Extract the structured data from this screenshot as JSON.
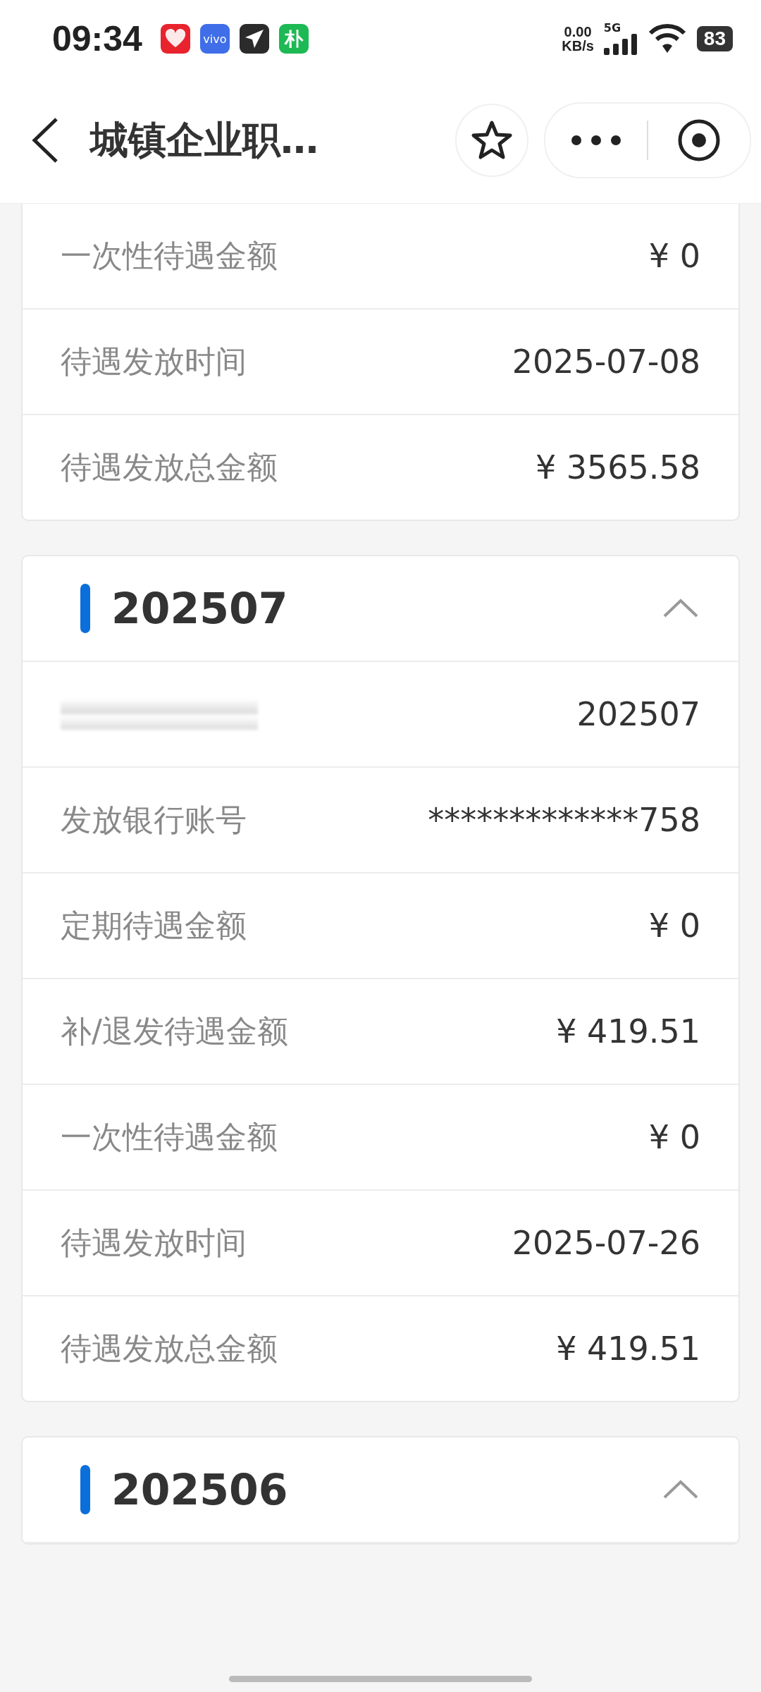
{
  "status_bar": {
    "time": "09:34",
    "apps": [
      {
        "kind": "heart",
        "color": "#e8232d"
      },
      {
        "kind": "text",
        "label": "vivo",
        "color": "#3f6ee8"
      },
      {
        "kind": "plane",
        "color": "#2b2b2b"
      },
      {
        "kind": "text",
        "label": "朴",
        "color": "#1db954"
      }
    ],
    "speed": "0.00",
    "speed_unit": "KB/s",
    "network": "5G",
    "battery": "83"
  },
  "header": {
    "title": "城镇企业职…"
  },
  "cards": [
    {
      "rows": [
        {
          "kind": "text",
          "label": "一次性待遇金额",
          "value": "¥ 0"
        },
        {
          "kind": "text",
          "label": "待遇发放时间",
          "value": "2025-07-08"
        },
        {
          "kind": "text",
          "label": "待遇发放总金额",
          "value": "¥ 3565.58"
        }
      ]
    },
    {
      "title": "202507",
      "expanded": true,
      "rows": [
        {
          "kind": "redacted",
          "value": "202507"
        },
        {
          "kind": "text",
          "label": "发放银行账号",
          "value": "*************758"
        },
        {
          "kind": "text",
          "label": "定期待遇金额",
          "value": "¥ 0"
        },
        {
          "kind": "text",
          "label": "补/退发待遇金额",
          "value": "¥ 419.51"
        },
        {
          "kind": "text",
          "label": "一次性待遇金额",
          "value": "¥ 0"
        },
        {
          "kind": "text",
          "label": "待遇发放时间",
          "value": "2025-07-26"
        },
        {
          "kind": "text",
          "label": "待遇发放总金额",
          "value": "¥ 419.51"
        }
      ]
    },
    {
      "title": "202506",
      "expanded": true
    }
  ]
}
